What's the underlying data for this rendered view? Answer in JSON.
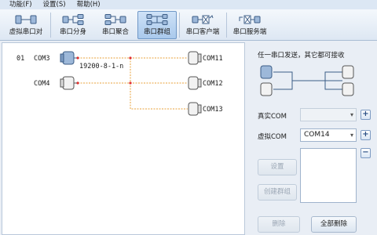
{
  "menu": {
    "items": [
      "功能(F)",
      "设置(S)",
      "帮助(H)"
    ]
  },
  "toolbar": {
    "buttons": [
      {
        "label": "虚拟串口对",
        "icon": "virtual-pair-icon"
      },
      {
        "label": "串口分身",
        "icon": "port-split-icon"
      },
      {
        "label": "串口聚合",
        "icon": "port-merge-icon"
      },
      {
        "label": "串口群组",
        "icon": "port-group-icon",
        "active": true
      },
      {
        "label": "串口客户端",
        "icon": "port-client-icon"
      },
      {
        "label": "串口服务端",
        "icon": "port-server-icon"
      }
    ]
  },
  "canvas": {
    "row_number": "01",
    "real_port": "COM3",
    "virtual_port": "COM4",
    "params": "19200-8-1-n",
    "targets": [
      "COM11",
      "COM12",
      "COM13"
    ]
  },
  "side": {
    "caption": "任一串口发送，其它都可接收",
    "real_com_label": "真实COM",
    "real_com_value": "",
    "virtual_com_label": "虚拟COM",
    "virtual_com_value": "COM14",
    "settings_btn": "设置",
    "create_group_btn": "创建群组",
    "delete_btn": "删除",
    "delete_all_btn": "全部删除"
  },
  "colors": {
    "accent": "#6f97c6",
    "connector_line": "#e8a23a",
    "connector_dot": "#e03030"
  }
}
